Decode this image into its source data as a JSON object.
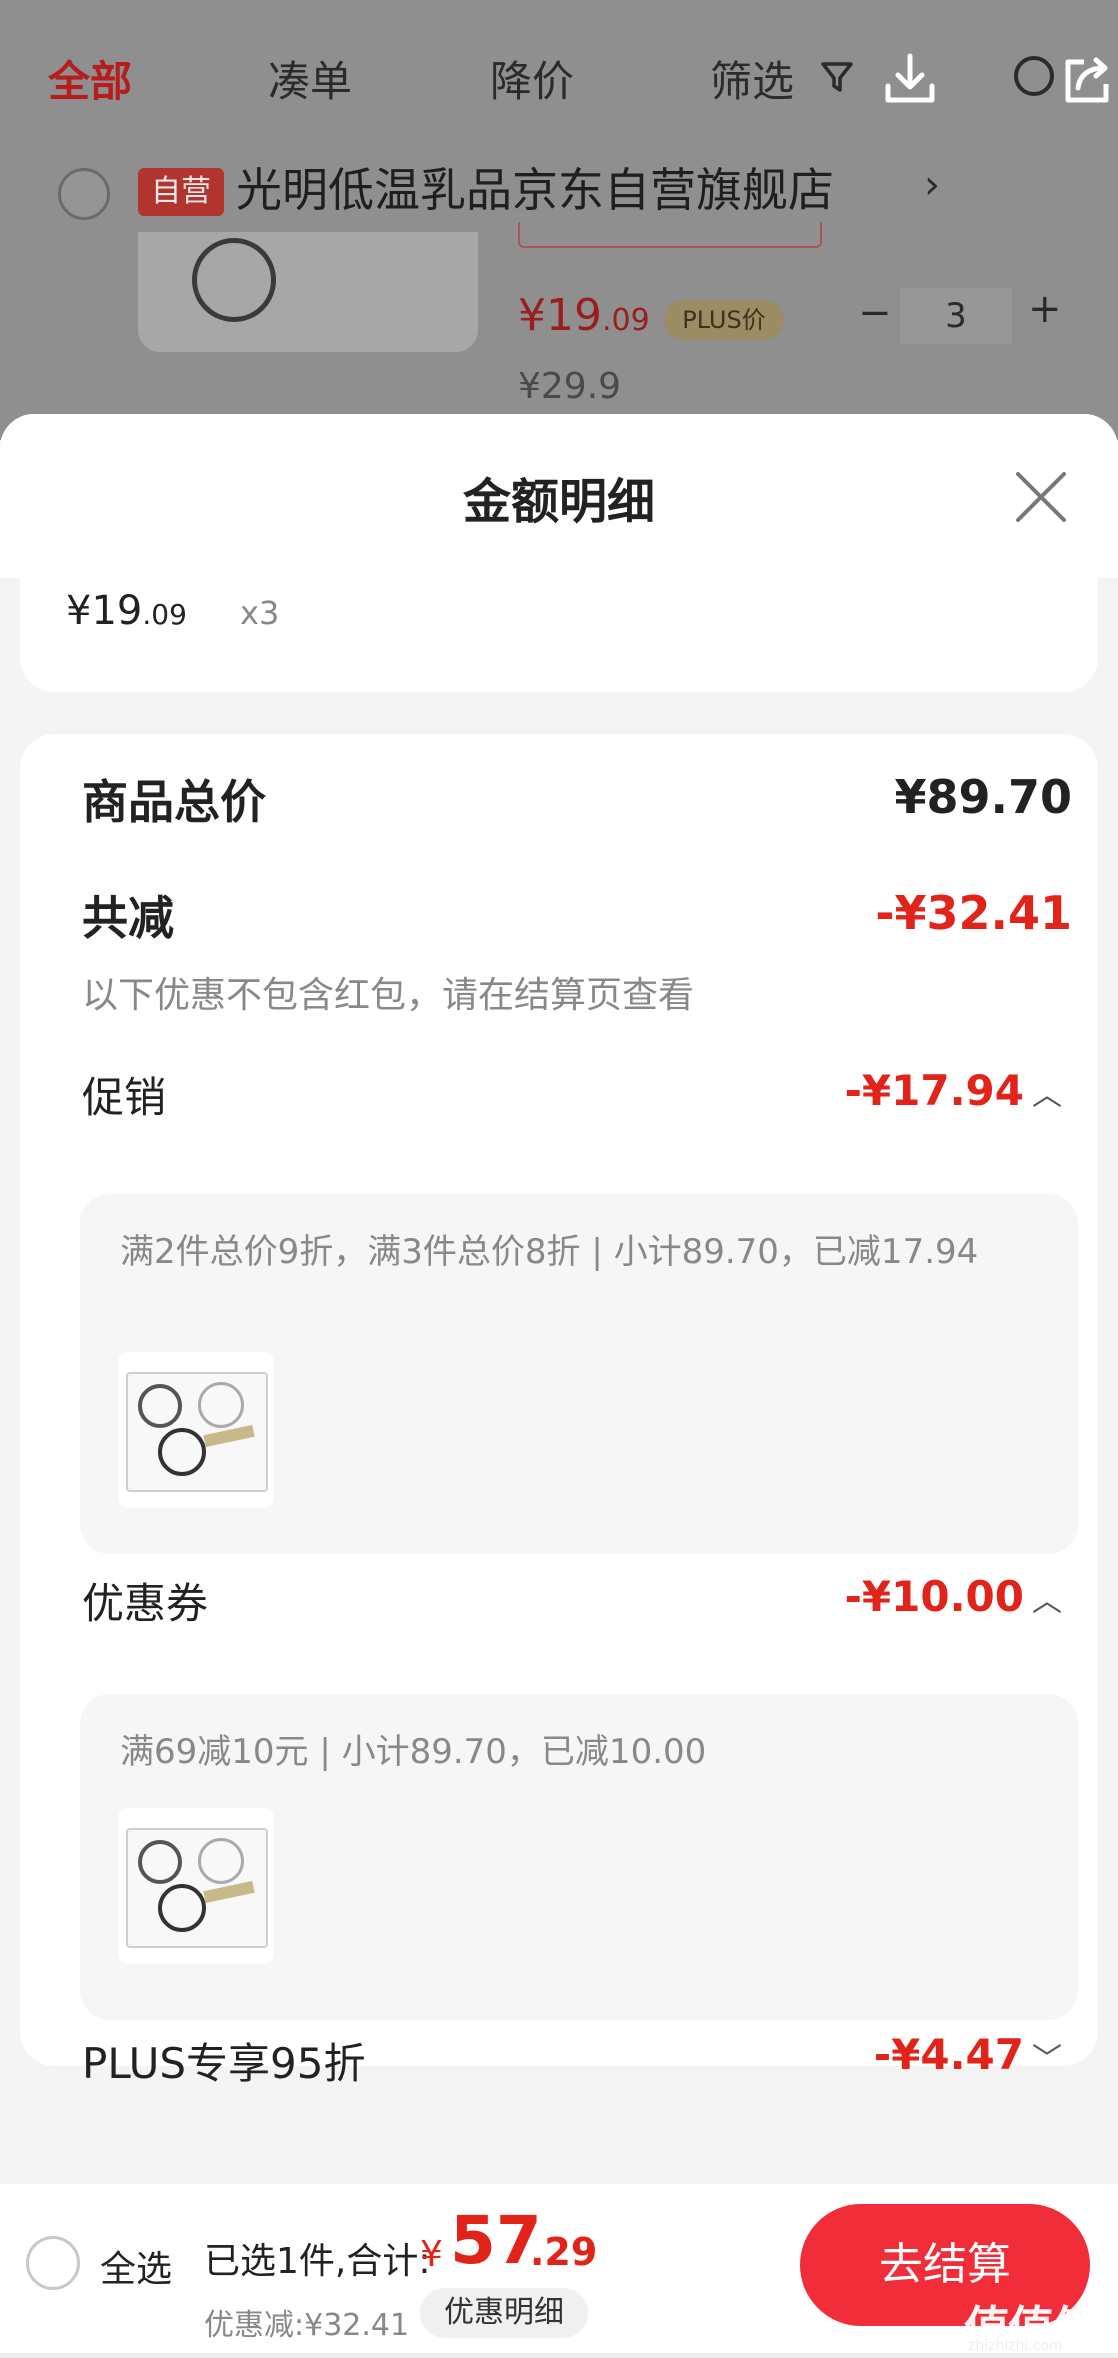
{
  "nav": {
    "tabs": [
      {
        "label": "全部",
        "active": true
      },
      {
        "label": "凑单"
      },
      {
        "label": "降价"
      },
      {
        "label": "筛选"
      }
    ],
    "icons": [
      "filter-icon",
      "download-icon",
      "search-icon",
      "share-icon"
    ]
  },
  "store": {
    "badge": "自营",
    "name": "光明低温乳品京东自营旗舰店",
    "chevron": "›"
  },
  "product": {
    "price_int": "¥19",
    "price_dec": ".09",
    "plus_badge": "PLUS价",
    "qty_minus": "−",
    "qty": "3",
    "qty_plus": "+",
    "original_price": "¥29.9"
  },
  "sheet": {
    "title": "金额明细",
    "item_price_int": "¥19",
    "item_price_dec": ".09",
    "item_qty": "x3",
    "total_label": "商品总价",
    "total_value": "¥89.70",
    "reduce_label": "共减",
    "reduce_value": "-¥32.41",
    "reduce_note": "以下优惠不包含红包，请在结算页查看",
    "promo": {
      "label": "促销",
      "value": "-¥17.94",
      "detail": "满2件总价9折，满3件总价8折 | 小计89.70，已减17.94"
    },
    "coupon": {
      "label": "优惠券",
      "value": "-¥10.00",
      "detail": "满69减10元 | 小计89.70，已减10.00"
    },
    "plus": {
      "label": "PLUS专享95折",
      "value": "-¥4.47"
    }
  },
  "bottom": {
    "select_all": "全选",
    "selected_text": "已选1件,合计:",
    "yen": "¥",
    "total_int": "57",
    "total_dec": ".29",
    "discount_text": "优惠减:¥32.41",
    "detail_button": "优惠明细",
    "checkout_button": "去结算",
    "watermark": "值值值",
    "watermark_sub": "zhizhizhi.com"
  },
  "colors": {
    "accent_red": "#e2231a",
    "checkout_red": "#f12d3a",
    "overlay_gray": "#8f8f8f"
  }
}
